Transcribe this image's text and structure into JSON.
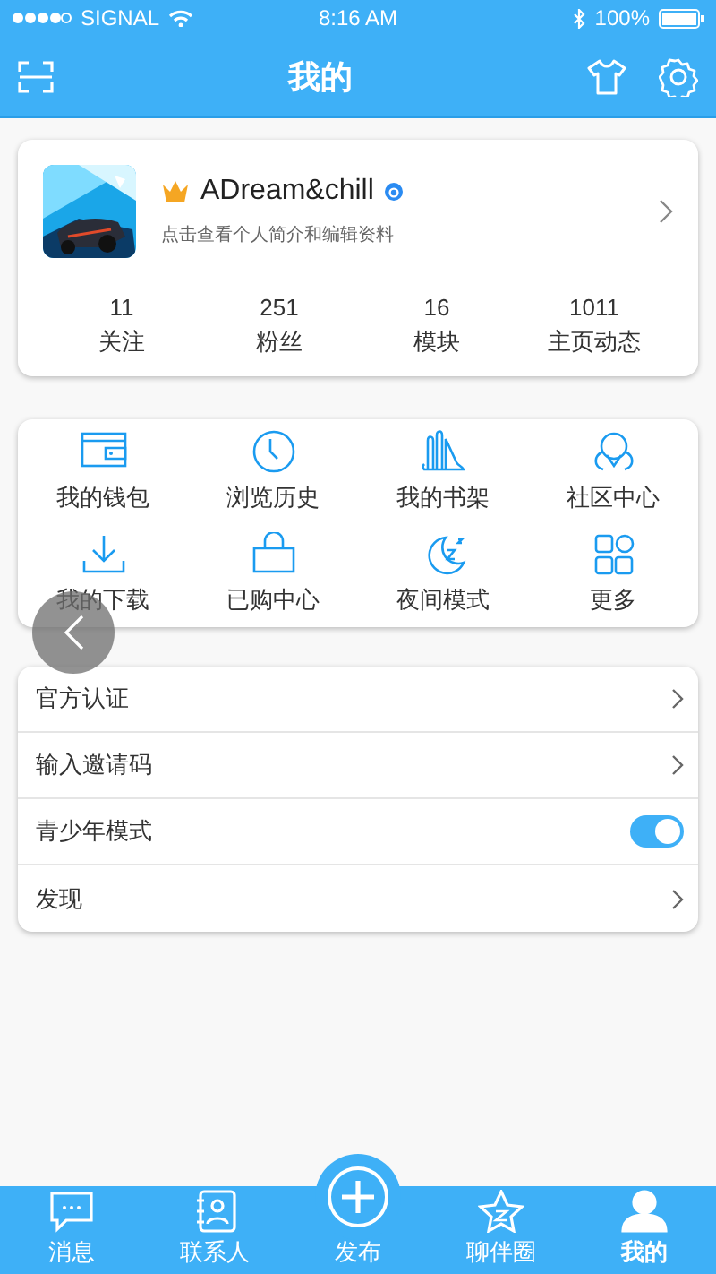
{
  "status_bar": {
    "carrier": "SIGNAL",
    "time": "8:16 AM",
    "battery": "100%"
  },
  "nav": {
    "title": "我的"
  },
  "profile": {
    "name": "ADream&chill",
    "subtitle": "点击查看个人简介和编辑资料",
    "stats": [
      {
        "value": "11",
        "label": "关注"
      },
      {
        "value": "251",
        "label": "粉丝"
      },
      {
        "value": "16",
        "label": "模块"
      },
      {
        "value": "1011",
        "label": "主页动态"
      }
    ]
  },
  "shortcuts": [
    {
      "kind": "wallet",
      "label": "我的钱包"
    },
    {
      "kind": "clock",
      "label": "浏览历史"
    },
    {
      "kind": "books",
      "label": "我的书架"
    },
    {
      "kind": "community",
      "label": "社区中心"
    },
    {
      "kind": "download",
      "label": "我的下载"
    },
    {
      "kind": "bag",
      "label": "已购中心"
    },
    {
      "kind": "moon",
      "label": "夜间模式"
    },
    {
      "kind": "grid",
      "label": "更多"
    }
  ],
  "settings": [
    {
      "kind": "link",
      "label": "官方认证"
    },
    {
      "kind": "link",
      "label": "输入邀请码"
    },
    {
      "kind": "toggle",
      "label": "青少年模式",
      "on": true
    },
    {
      "kind": "link",
      "label": "发现"
    }
  ],
  "tab_bar": [
    {
      "kind": "chat",
      "label": "消息",
      "selected": false
    },
    {
      "kind": "contacts",
      "label": "联系人",
      "selected": false
    },
    {
      "kind": "plus",
      "label": "发布",
      "selected": false
    },
    {
      "kind": "star",
      "label": "聊伴圈",
      "selected": false
    },
    {
      "kind": "person",
      "label": "我的",
      "selected": true
    }
  ]
}
